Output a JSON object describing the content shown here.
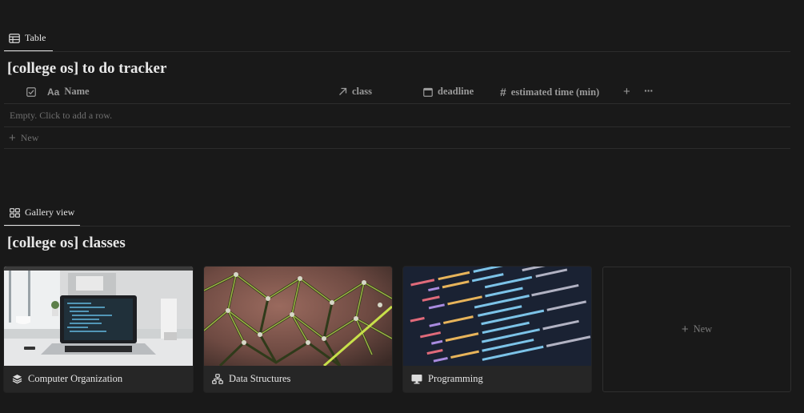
{
  "table_view": {
    "tab_label": "Table",
    "title": "[college os] to do tracker",
    "columns": [
      {
        "icon": "checkbox-icon",
        "label": "Name",
        "prefix": "Aa"
      },
      {
        "icon": "relation-arrow-icon",
        "label": "class"
      },
      {
        "icon": "calendar-icon",
        "label": "deadline"
      },
      {
        "icon": "hash-icon",
        "label": "estimated time (min)"
      }
    ],
    "empty_text": "Empty. Click to add a row.",
    "new_label": "New",
    "add_column": "+",
    "more": "···"
  },
  "gallery_view": {
    "tab_label": "Gallery view",
    "title": "[college os] classes",
    "cards": [
      {
        "icon": "layers-icon",
        "label": "Computer Organization"
      },
      {
        "icon": "hierarchy-icon",
        "label": "Data Structures"
      },
      {
        "icon": "monitor-icon",
        "label": "Programming"
      }
    ],
    "new_label": "New"
  }
}
